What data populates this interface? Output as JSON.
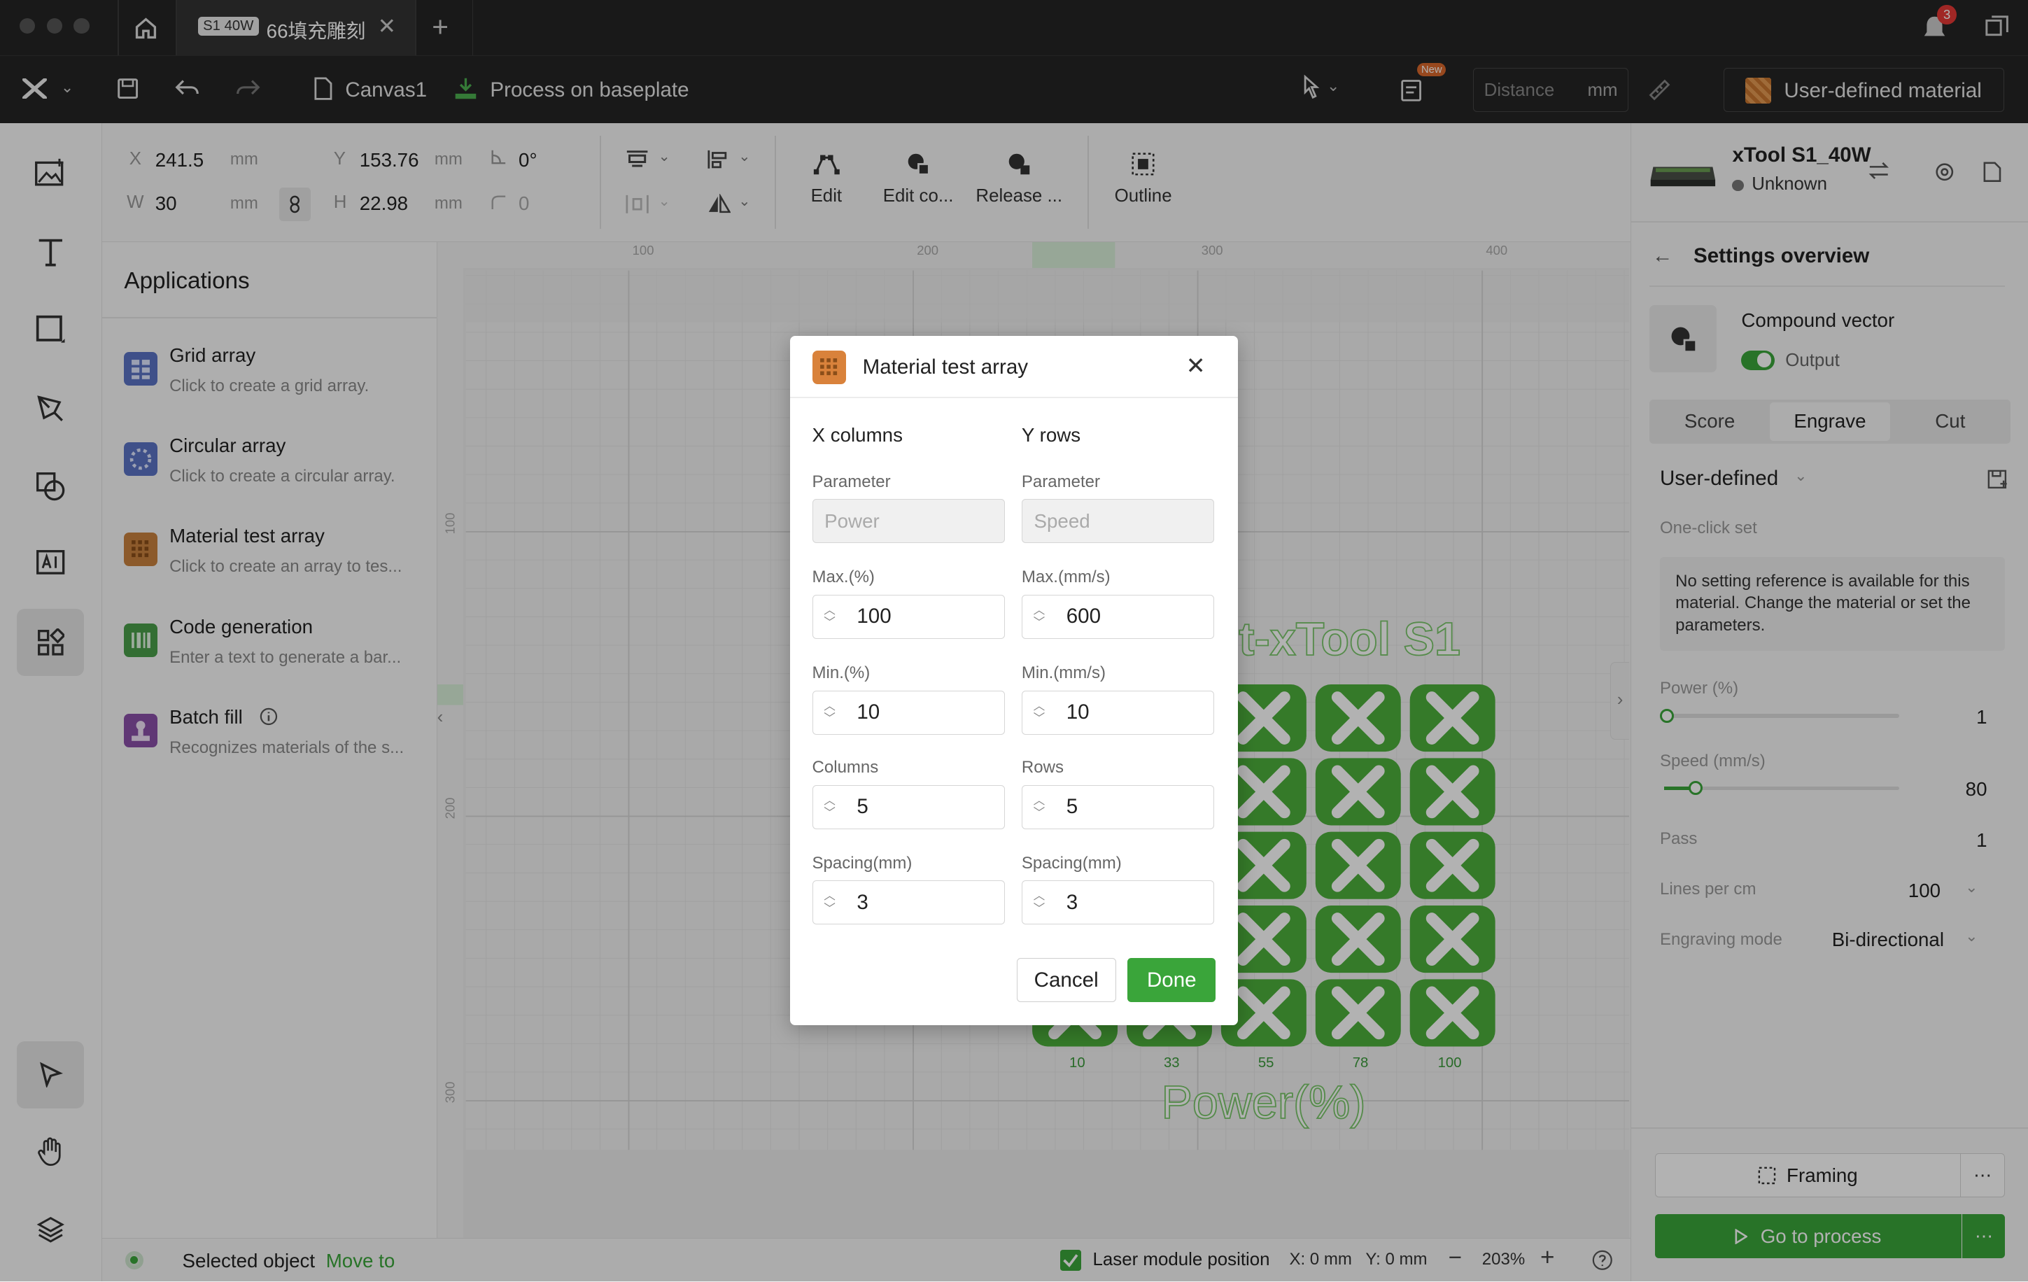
{
  "titlebar": {
    "tab_chip": "S1 40W",
    "tab_title": "66填充雕刻",
    "notification_count": "3"
  },
  "toolbar": {
    "canvas_name": "Canvas1",
    "process_label": "Process on baseplate",
    "new_badge": "New",
    "distance_placeholder": "Distance",
    "distance_unit": "mm",
    "material_label": "User-defined material"
  },
  "props": {
    "x_label": "X",
    "x_value": "241.5",
    "x_unit": "mm",
    "y_label": "Y",
    "y_value": "153.76",
    "y_unit": "mm",
    "angle_value": "0°",
    "w_label": "W",
    "w_value": "30",
    "w_unit": "mm",
    "h_label": "H",
    "h_value": "22.98",
    "h_unit": "mm",
    "radius_value": "0",
    "edit": "Edit",
    "edit_compound": "Edit co...",
    "release": "Release ...",
    "outline": "Outline"
  },
  "apps": {
    "header": "Applications",
    "items": [
      {
        "title": "Grid array",
        "desc": "Click to create a grid array."
      },
      {
        "title": "Circular array",
        "desc": "Click to create a circular array."
      },
      {
        "title": "Material test array",
        "desc": "Click to create an array to tes..."
      },
      {
        "title": "Code generation",
        "desc": "Enter a text to generate a bar..."
      },
      {
        "title": "Batch fill",
        "desc": "Recognizes materials of the s..."
      }
    ]
  },
  "canvas": {
    "ruler_top": [
      "100",
      "200",
      "300",
      "400"
    ],
    "ruler_left": [
      "100",
      "200",
      "300"
    ],
    "test_title": "est-xTool S1",
    "axis_values": [
      "10",
      "33",
      "55",
      "78",
      "100"
    ],
    "axis_title": "Power(%)"
  },
  "right": {
    "device_name": "xTool S1_40W",
    "device_status": "Unknown",
    "overview_title": "Settings overview",
    "object_type": "Compound vector",
    "output_label": "Output",
    "tabs": [
      "Score",
      "Engrave",
      "Cut"
    ],
    "active_tab": "Engrave",
    "preset": "User-defined",
    "one_click": "One-click set",
    "notice": "No setting reference is available for this material. Change the material or set the parameters.",
    "power_label": "Power (%)",
    "power_value": "1",
    "speed_label": "Speed (mm/s)",
    "speed_value": "80",
    "pass_label": "Pass",
    "pass_value": "1",
    "lines_label": "Lines per cm",
    "lines_value": "100",
    "mode_label": "Engraving mode",
    "mode_value": "Bi-directional",
    "framing": "Framing",
    "go_process": "Go to process"
  },
  "status": {
    "selected": "Selected object",
    "move_to": "Move to",
    "laser_position": "Laser module position",
    "coords": "X: 0 mm   Y: 0 mm",
    "zoom": "203%"
  },
  "dialog": {
    "title": "Material test array",
    "x_header": "X columns",
    "y_header": "Y rows",
    "param_label": "Parameter",
    "x_param": "Power",
    "y_param": "Speed",
    "x_max_label": "Max.(%)",
    "x_max": "100",
    "y_max_label": "Max.(mm/s)",
    "y_max": "600",
    "x_min_label": "Min.(%)",
    "x_min": "10",
    "y_min_label": "Min.(mm/s)",
    "y_min": "10",
    "columns_label": "Columns",
    "columns": "5",
    "rows_label": "Rows",
    "rows": "5",
    "spacing_label": "Spacing(mm)",
    "x_spacing": "3",
    "y_spacing": "3",
    "cancel": "Cancel",
    "done": "Done"
  },
  "colors": {
    "accent_green": "#3aa53a",
    "tile_green": "#4caf3c",
    "dark_bar": "#242424",
    "material_orange": "#d9823b"
  }
}
